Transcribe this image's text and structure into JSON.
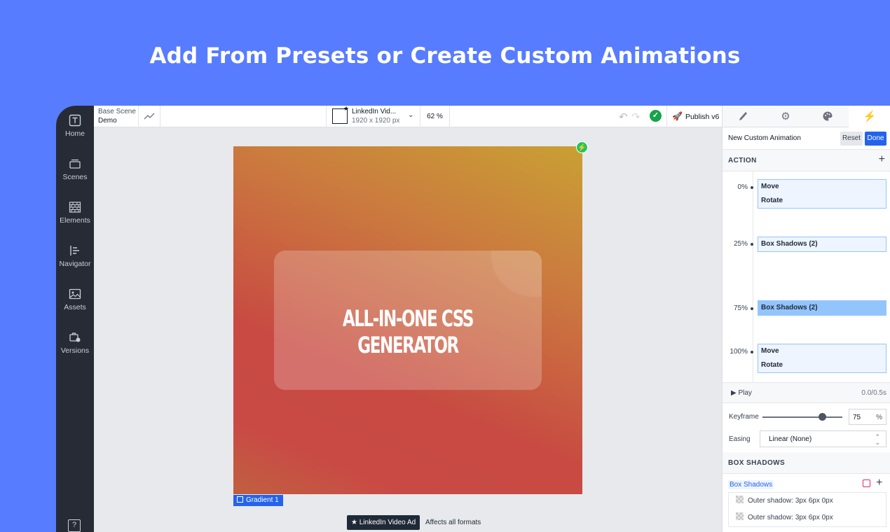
{
  "headline": "Add From Presets or Create Custom Animations",
  "sidebar": {
    "items": [
      {
        "label": "Home",
        "icon": "text-box-icon"
      },
      {
        "label": "Scenes",
        "icon": "layers-stack-icon"
      },
      {
        "label": "Elements",
        "icon": "brick-wall-icon"
      },
      {
        "label": "Navigator",
        "icon": "tree-list-icon"
      },
      {
        "label": "Assets",
        "icon": "image-icon"
      },
      {
        "label": "Versions",
        "icon": "briefcase-clock-icon"
      }
    ],
    "help_symbol": "?"
  },
  "topbar": {
    "scene_label": "Base Scene",
    "scene_name": "Demo",
    "format_name": "LinkedIn Vid...",
    "format_size": "1920 x 1920 px",
    "zoom": "62 %",
    "publish_label": "Publish v6"
  },
  "canvas": {
    "card_title": "ALL-IN-ONE CSS GENERATOR",
    "layer_name": "Gradient 1",
    "format_chip": "LinkedIn Video Ad",
    "format_note": "Affects all formats"
  },
  "panel": {
    "tabs": [
      "brush-icon",
      "gear-icon",
      "palette-icon",
      "bolt-icon"
    ],
    "animation_title": "New Custom Animation",
    "reset_label": "Reset",
    "done_label": "Done",
    "action_header": "ACTION",
    "keyframes": [
      {
        "label": "0%",
        "props": [
          "Move",
          "Rotate"
        ],
        "active": false
      },
      {
        "label": "25%",
        "props": [
          "Box Shadows (2)"
        ],
        "active": false
      },
      {
        "label": "75%",
        "props": [
          "Box Shadows (2)"
        ],
        "active": true
      },
      {
        "label": "100%",
        "props": [
          "Move",
          "Rotate"
        ],
        "active": false
      }
    ],
    "play_label": "Play",
    "play_time": "0.0/0.5s",
    "keyframe_label": "Keyframe",
    "keyframe_value": "75",
    "keyframe_unit": "%",
    "keyframe_fraction": 0.75,
    "easing_label": "Easing",
    "easing_value": "Linear (None)",
    "box_shadows_header": "BOX SHADOWS",
    "box_shadows_label": "Box Shadows",
    "shadows": [
      "Outer shadow: 3px 6px 0px",
      "Outer shadow: 3px 6px 0px"
    ]
  },
  "colors": {
    "background": "#577cff",
    "accent": "#2563eb",
    "success": "#16a34a",
    "sidebar": "#262b36"
  }
}
